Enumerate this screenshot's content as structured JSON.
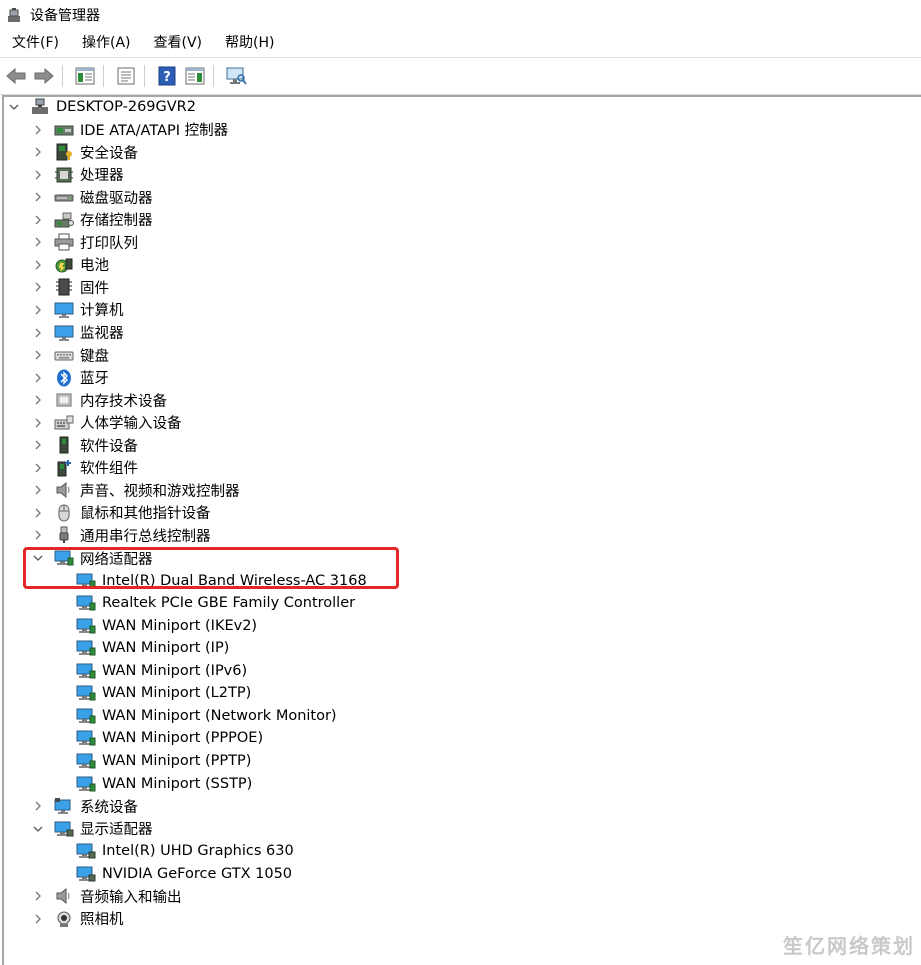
{
  "window": {
    "title": "设备管理器"
  },
  "menu": [
    "文件(F)",
    "操作(A)",
    "查看(V)",
    "帮助(H)"
  ],
  "tree": {
    "root": "DESKTOP-269GVR2",
    "categories": [
      {
        "label": "IDE ATA/ATAPI 控制器",
        "icon": "ide-controller-icon",
        "expanded": false
      },
      {
        "label": "安全设备",
        "icon": "security-device-icon",
        "expanded": false
      },
      {
        "label": "处理器",
        "icon": "processor-icon",
        "expanded": false
      },
      {
        "label": "磁盘驱动器",
        "icon": "disk-drive-icon",
        "expanded": false
      },
      {
        "label": "存储控制器",
        "icon": "storage-controller-icon",
        "expanded": false
      },
      {
        "label": "打印队列",
        "icon": "printer-icon",
        "expanded": false
      },
      {
        "label": "电池",
        "icon": "battery-icon",
        "expanded": false
      },
      {
        "label": "固件",
        "icon": "firmware-icon",
        "expanded": false
      },
      {
        "label": "计算机",
        "icon": "computer-icon",
        "expanded": false
      },
      {
        "label": "监视器",
        "icon": "monitor-icon",
        "expanded": false
      },
      {
        "label": "键盘",
        "icon": "keyboard-icon",
        "expanded": false
      },
      {
        "label": "蓝牙",
        "icon": "bluetooth-icon",
        "expanded": false
      },
      {
        "label": "内存技术设备",
        "icon": "memory-device-icon",
        "expanded": false
      },
      {
        "label": "人体学输入设备",
        "icon": "hid-icon",
        "expanded": false
      },
      {
        "label": "软件设备",
        "icon": "software-device-icon",
        "expanded": false
      },
      {
        "label": "软件组件",
        "icon": "software-component-icon",
        "expanded": false
      },
      {
        "label": "声音、视频和游戏控制器",
        "icon": "sound-icon",
        "expanded": false
      },
      {
        "label": "鼠标和其他指针设备",
        "icon": "mouse-icon",
        "expanded": false
      },
      {
        "label": "通用串行总线控制器",
        "icon": "usb-icon",
        "expanded": false
      },
      {
        "label": "网络适配器",
        "icon": "network-adapter-icon",
        "expanded": true,
        "children": [
          "Intel(R) Dual Band Wireless-AC 3168",
          "Realtek PCIe GBE Family Controller",
          "WAN Miniport (IKEv2)",
          "WAN Miniport (IP)",
          "WAN Miniport (IPv6)",
          "WAN Miniport (L2TP)",
          "WAN Miniport (Network Monitor)",
          "WAN Miniport (PPPOE)",
          "WAN Miniport (PPTP)",
          "WAN Miniport (SSTP)"
        ]
      },
      {
        "label": "系统设备",
        "icon": "system-device-icon",
        "expanded": false
      },
      {
        "label": "显示适配器",
        "icon": "display-adapter-icon",
        "expanded": true,
        "children": [
          "Intel(R) UHD Graphics 630",
          "NVIDIA GeForce GTX 1050"
        ]
      },
      {
        "label": "音频输入和输出",
        "icon": "audio-io-icon",
        "expanded": false
      },
      {
        "label": "照相机",
        "icon": "camera-icon",
        "expanded": false
      }
    ]
  },
  "watermark": "笙亿网络策划",
  "colors": {
    "highlight": "#e4262a",
    "accent": "#1a6fc7"
  }
}
